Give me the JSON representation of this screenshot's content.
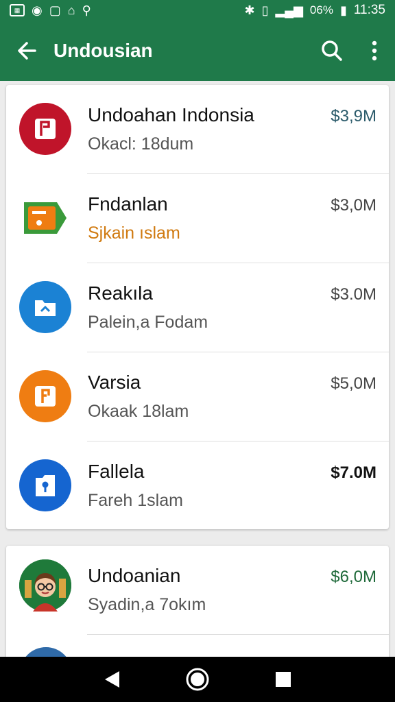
{
  "status_bar": {
    "battery_percent": "06%",
    "time": "11:35"
  },
  "app_bar": {
    "title": "Undousian"
  },
  "list": [
    {
      "title": "Undoahan Indonsia",
      "subtitle": "Okacl: 18dum",
      "amount": "$3,9M",
      "icon": "flag-icon",
      "icon_color": "#c0142a",
      "subtitle_color": "#555555",
      "amount_color": "#2a5a6a"
    },
    {
      "title": "Fndanlan",
      "subtitle": "Sjkain ıslam",
      "amount": "$3,0M",
      "icon": "wallet-icon",
      "icon_color": "#3a9a3a",
      "subtitle_color": "#d07a10",
      "amount_color": "#444444"
    },
    {
      "title": "Reakıla",
      "subtitle": "Palein,a Fodam",
      "amount": "$3.0M",
      "icon": "folder-icon",
      "icon_color": "#1b82d4",
      "subtitle_color": "#555555",
      "amount_color": "#444444"
    },
    {
      "title": "Varsia",
      "subtitle": "Okaak 18lam",
      "amount": "$5,0M",
      "icon": "flag-icon",
      "icon_color": "#ef7d12",
      "subtitle_color": "#555555",
      "amount_color": "#444444"
    },
    {
      "title": "Fallela",
      "subtitle": "Fareh 1slam",
      "amount": "$7.0M",
      "icon": "lock-icon",
      "icon_color": "#1565d0",
      "subtitle_color": "#555555",
      "amount_color": "#111111"
    }
  ],
  "list2": [
    {
      "title": "Undoanian",
      "subtitle": "Syadin,a 7okım",
      "amount": "$6,0M",
      "icon": "avatar",
      "icon_color": "#1f7a3a",
      "subtitle_color": "#555555",
      "amount_color": "#1f6a3a"
    }
  ]
}
